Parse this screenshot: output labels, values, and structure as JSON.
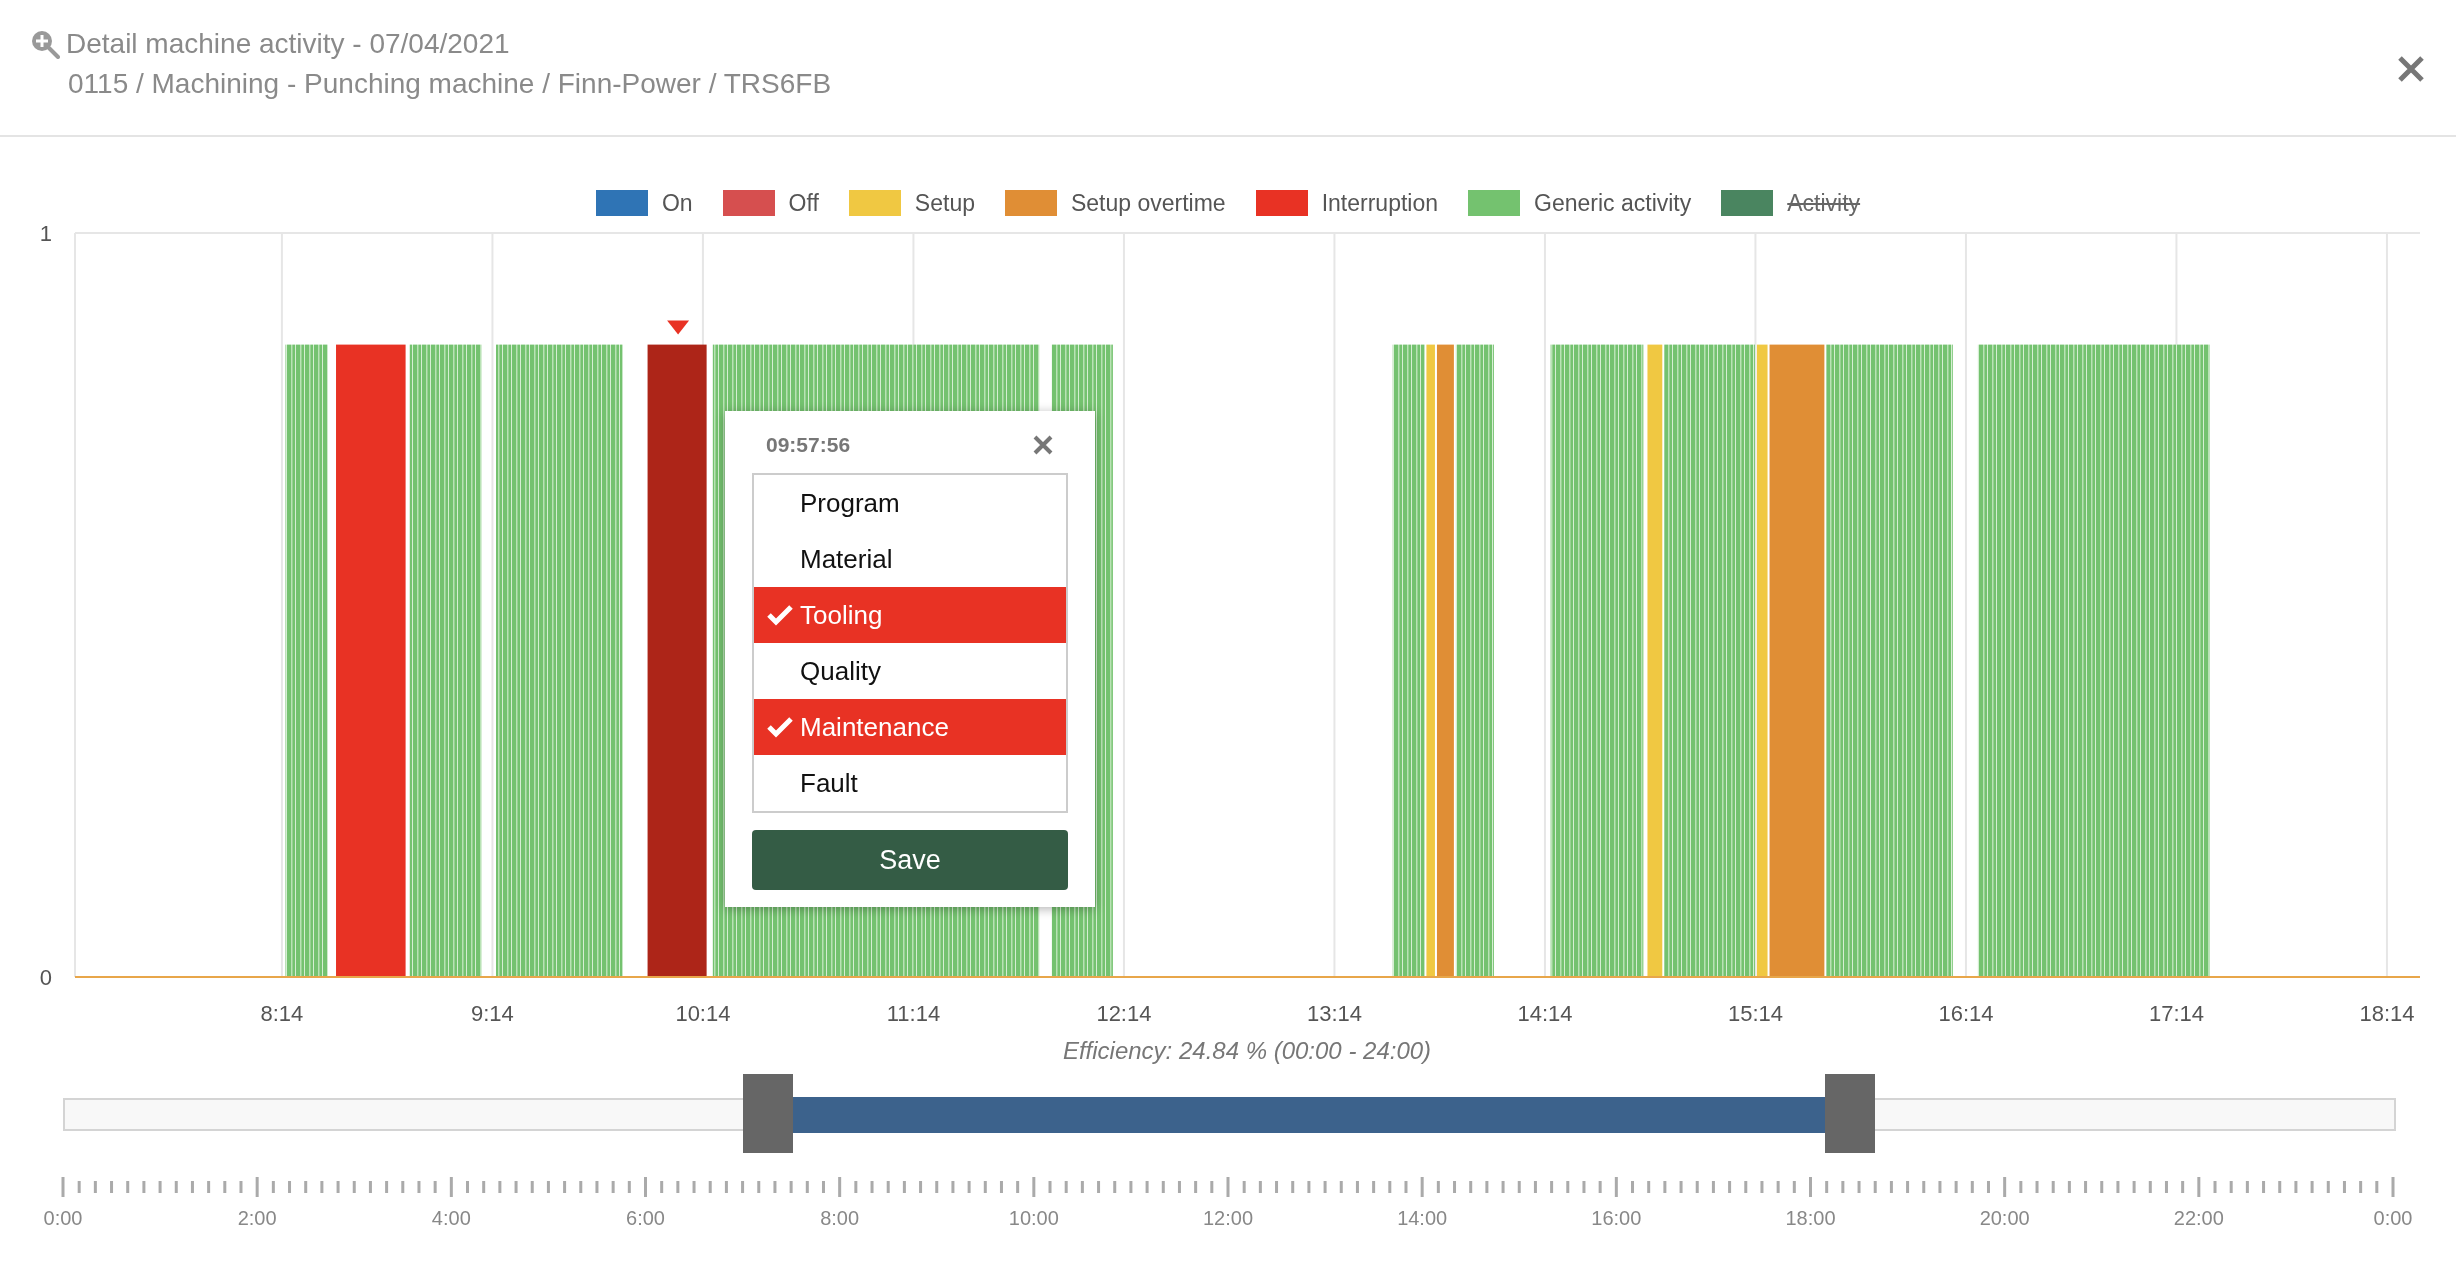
{
  "header": {
    "title": "Detail machine activity - 07/04/2021",
    "subtitle": "0115 / Machining - Punching machine / Finn-Power / TRS6FB"
  },
  "chart": {
    "legend": [
      {
        "label": "On",
        "color": "#2f74b5",
        "hidden": false
      },
      {
        "label": "Off",
        "color": "#d64f4f",
        "hidden": false
      },
      {
        "label": "Setup",
        "color": "#f0c842",
        "hidden": false
      },
      {
        "label": "Setup overtime",
        "color": "#e08e35",
        "hidden": false
      },
      {
        "label": "Interruption",
        "color": "#e83224",
        "hidden": false
      },
      {
        "label": "Generic activity",
        "color": "#74c26f",
        "hidden": false
      },
      {
        "label": "Activity",
        "color": "#4a8560",
        "hidden": true
      }
    ],
    "y_labels": [
      "1",
      "0"
    ],
    "x_labels": [
      "8:14",
      "9:14",
      "10:14",
      "11:14",
      "12:14",
      "13:14",
      "14:14",
      "15:14",
      "16:14",
      "17:14",
      "18:14"
    ]
  },
  "popup": {
    "time": "09:57:56",
    "items": [
      {
        "label": "Program",
        "selected": false
      },
      {
        "label": "Material",
        "selected": false
      },
      {
        "label": "Tooling",
        "selected": true
      },
      {
        "label": "Quality",
        "selected": false
      },
      {
        "label": "Maintenance",
        "selected": true
      },
      {
        "label": "Fault",
        "selected": false
      }
    ],
    "button": "Save"
  },
  "efficiency": "Efficiency: 24.84 % (00:00 - 24:00)",
  "navigator": {
    "start": {
      "level": 0.302
    },
    "end": {
      "level": 0.766
    },
    "tick_labels": [
      "0:00",
      "2:00",
      "4:00",
      "6:00",
      "8:00",
      "10:00",
      "12:00",
      "14:00",
      "16:00",
      "18:00",
      "20:00",
      "22:00",
      "0:00"
    ]
  }
}
